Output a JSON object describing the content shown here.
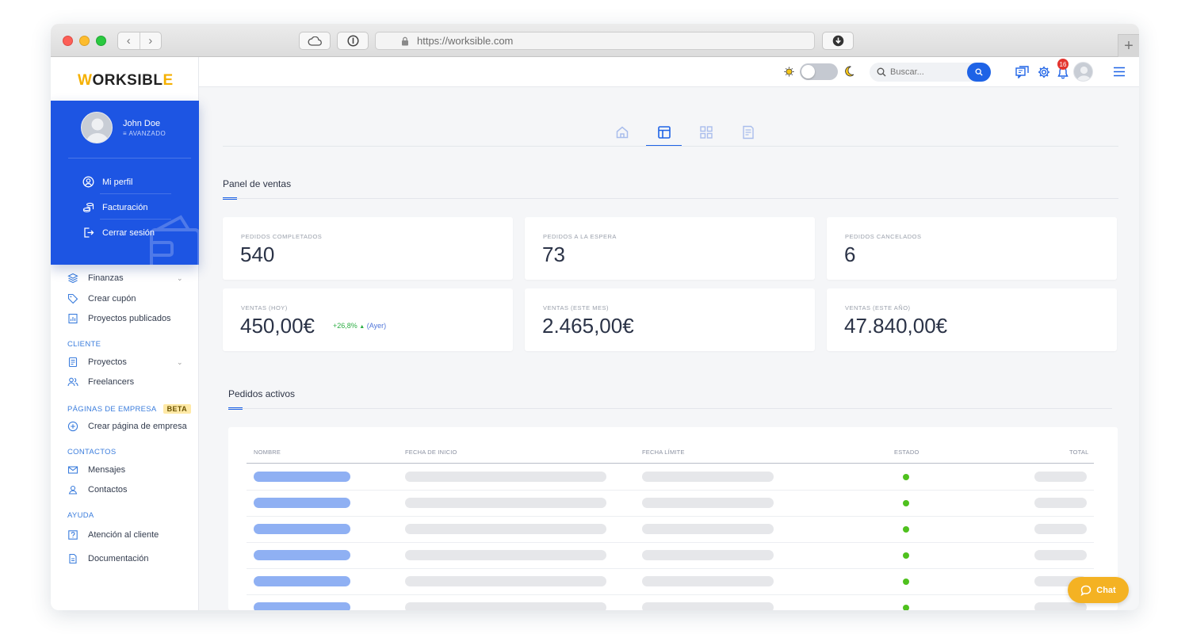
{
  "browser": {
    "url": "https://worksible.com",
    "new_tab_label": "+"
  },
  "app": {
    "logo_prefix": "W",
    "logo_middle": "ORKSIBL",
    "logo_suffix": "E"
  },
  "profile_menu": {
    "name": "John Doe",
    "role": "≡ AVANZADO",
    "items": [
      {
        "label": "Mi perfil",
        "icon": "user-circle-icon"
      },
      {
        "label": "Facturación",
        "icon": "coins-icon"
      },
      {
        "label": "Cerrar sesión",
        "icon": "logout-icon"
      }
    ]
  },
  "sidebar": {
    "items_top": [
      {
        "label": "Finanzas",
        "icon": "layers-icon",
        "has_chevron": true
      },
      {
        "label": "Crear cupón",
        "icon": "tag-icon",
        "has_chevron": false
      },
      {
        "label": "Proyectos publicados",
        "icon": "chart-doc-icon",
        "has_chevron": false
      }
    ],
    "section_cliente": "CLIENTE",
    "items_cliente": [
      {
        "label": "Proyectos",
        "icon": "clipboard-icon",
        "has_chevron": true
      },
      {
        "label": "Freelancers",
        "icon": "users-icon",
        "has_chevron": false
      }
    ],
    "section_empresa": "PÁGINAS DE EMPRESA",
    "beta_badge": "BETA",
    "items_empresa": [
      {
        "label": "Crear página de empresa",
        "icon": "plus-circle-icon"
      }
    ],
    "section_contactos": "CONTACTOS",
    "items_contactos": [
      {
        "label": "Mensajes",
        "icon": "mail-icon"
      },
      {
        "label": "Contactos",
        "icon": "contacts-icon"
      }
    ],
    "section_ayuda": "AYUDA",
    "items_ayuda": [
      {
        "label": "Atención al cliente",
        "icon": "help-box-icon"
      },
      {
        "label": "Documentación",
        "icon": "document-icon"
      }
    ],
    "chevron": "⌄"
  },
  "topbar": {
    "search_placeholder": "Buscar...",
    "notification_count": "16",
    "theme_toggle_on": false
  },
  "main": {
    "panel_title": "Panel de ventas",
    "stats": [
      {
        "label": "PEDIDOS COMPLETADOS",
        "value": "540"
      },
      {
        "label": "PEDIDOS A LA ESPERA",
        "value": "73"
      },
      {
        "label": "PEDIDOS CANCELADOS",
        "value": "6"
      },
      {
        "label": "VENTAS (HOY)",
        "value": "450,00€",
        "delta": "+26,8%",
        "delta_arrow": "▲",
        "delta_ref": "(Ayer)"
      },
      {
        "label": "VENTAS (ESTE MES)",
        "value": "2.465,00€"
      },
      {
        "label": "VENTAS (ESTE AÑO)",
        "value": "47.840,00€"
      }
    ],
    "orders_title": "Pedidos activos",
    "table_headers": [
      "NOMBRE",
      "FECHA DE INICIO",
      "FECHA LÍMITE",
      "ESTADO",
      "TOTAL"
    ]
  },
  "chat": {
    "label": "Chat"
  },
  "colors": {
    "primary": "#1e63e6",
    "profile_bg": "#1d55e3",
    "accent_yellow": "#f4b223",
    "status_green": "#4fc11e"
  }
}
